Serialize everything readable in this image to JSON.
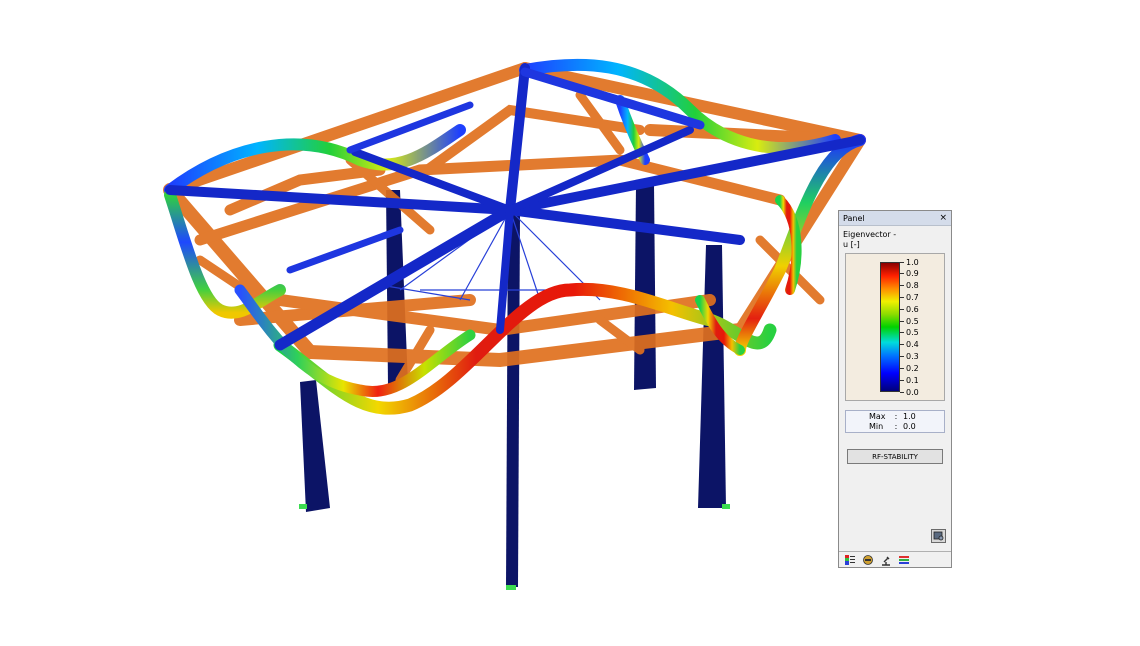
{
  "panel": {
    "title": "Panel",
    "close_glyph": "×",
    "result_label": "Eigenvector -",
    "unit_label": "u [-]",
    "legend_values": [
      "1.0",
      "0.9",
      "0.8",
      "0.7",
      "0.6",
      "0.5",
      "0.5",
      "0.4",
      "0.3",
      "0.2",
      "0.1",
      "0.0"
    ],
    "max_label": "Max",
    "max_value": "1.0",
    "min_label": "Min",
    "min_value": "0.0",
    "separator": ":",
    "module_button": "RF-STABILITY",
    "bottom_icons": [
      "color-scale-icon",
      "results-filter-icon",
      "microscope-icon",
      "layers-icon"
    ]
  },
  "colors": {
    "members_orange": "#e0701e",
    "members_blue": "#1428c8",
    "columns_navy": "#0c1466",
    "supports_green": "#3cdc50"
  }
}
